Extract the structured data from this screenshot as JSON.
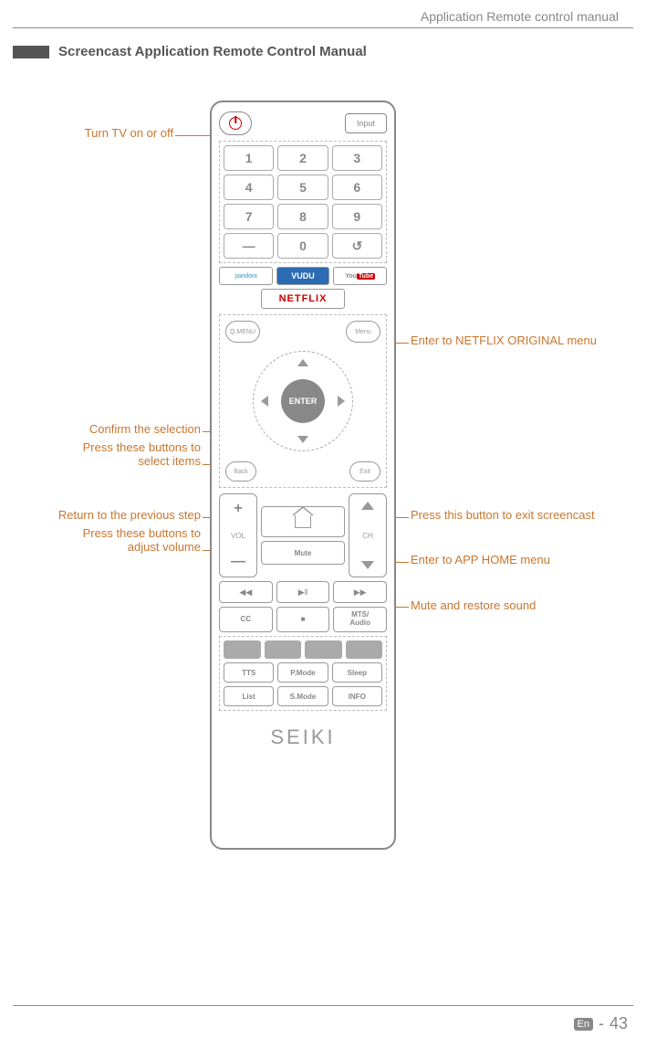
{
  "header": {
    "right": "Application Remote control manual"
  },
  "section_title": "Screencast Application Remote Control Manual",
  "remote": {
    "input": "Input",
    "numbers": [
      "1",
      "2",
      "3",
      "4",
      "5",
      "6",
      "7",
      "8",
      "9",
      "—",
      "0",
      "↺"
    ],
    "services": {
      "pandora": "pandora",
      "vudu": "VUDU",
      "youtube_a": "You",
      "youtube_b": "Tube",
      "netflix": "NETFLIX"
    },
    "nav": {
      "qmenu": "Q.MENU",
      "menu": "Menu",
      "enter": "ENTER",
      "back": "Back",
      "exit": "Exit"
    },
    "rockers": {
      "vol": "VOL",
      "vol_plus": "+",
      "vol_minus": "—",
      "ch": "CH",
      "mute": "Mute"
    },
    "media": {
      "rew": "◀◀",
      "playpause": "▶‖",
      "ff": "▶▶"
    },
    "cc_row": {
      "cc": "CC",
      "stop": "■",
      "mts": "MTS/\nAudio"
    },
    "fn1": {
      "tts": "TTS",
      "pmode": "P.Mode",
      "sleep": "Sleep"
    },
    "fn2": {
      "list": "List",
      "smode": "S.Mode",
      "info": "INFO"
    },
    "brand": "SEIKI"
  },
  "callouts": {
    "power": "Turn TV on or off",
    "confirm": "Confirm the selection",
    "select": "Press these buttons to\nselect items",
    "previous": "Return to the previous step",
    "volume": "Press these buttons to\nadjust volume",
    "netflix": "Enter to NETFLIX ORIGINAL menu",
    "exit": "Press this button to exit screencast",
    "home": "Enter to APP HOME menu",
    "mute": "Mute and restore sound"
  },
  "footer": {
    "lang": "En",
    "sep": "-",
    "page": "43"
  }
}
